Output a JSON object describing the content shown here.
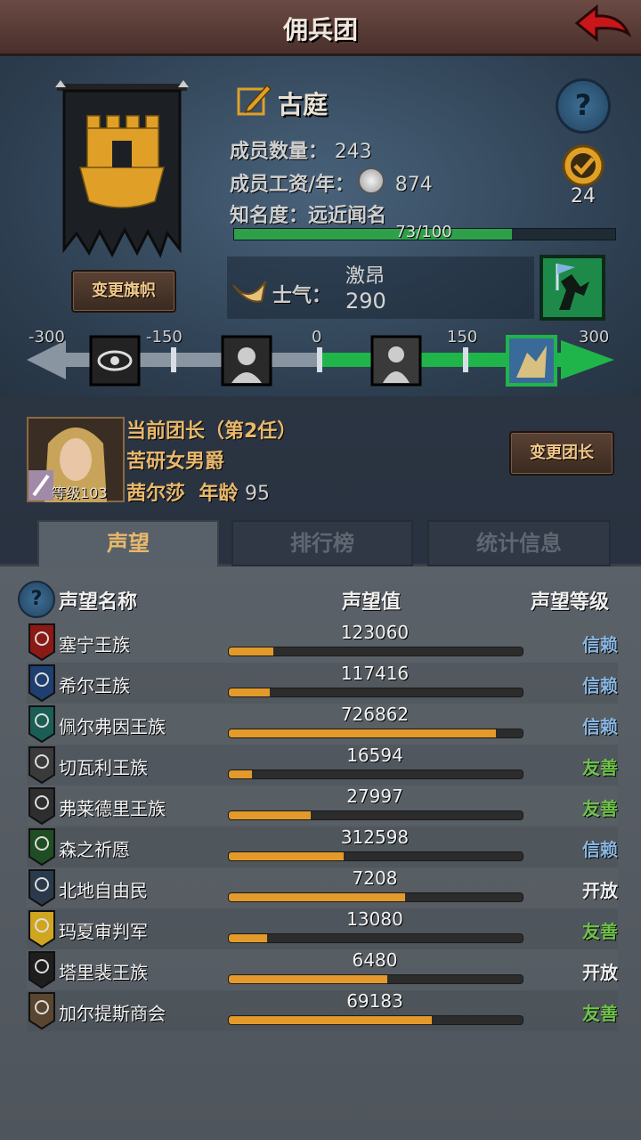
{
  "header": {
    "title": "佣兵团"
  },
  "guild": {
    "name": "古庭",
    "members_label": "成员数量：",
    "members_value": "243",
    "wage_label": "成员工资/年：",
    "wage_value": "874",
    "fame_label": "知名度：",
    "fame_value": "远近闻名",
    "fame_progress_text": "73/100",
    "fame_progress_fraction": 0.73,
    "rank": "24",
    "change_banner_label": "变更旗帜",
    "help_label": "?"
  },
  "morale": {
    "label": "士气：",
    "state": "激昂",
    "value": "290",
    "ticks": [
      "-300",
      "-150",
      "0",
      "150",
      "300"
    ]
  },
  "leader": {
    "title": "当前团长（第2任）",
    "rank_title": "苦研女男爵",
    "level_text": "等级103",
    "name": "茜尔莎",
    "age_label": "年龄",
    "age": "95",
    "change_leader_label": "变更团长"
  },
  "tabs": [
    {
      "label": "声望"
    },
    {
      "label": "排行榜"
    },
    {
      "label": "统计信息"
    }
  ],
  "reputation": {
    "help_label": "?",
    "col_name": "声望名称",
    "col_value": "声望值",
    "col_level": "声望等级",
    "rows": [
      {
        "name": "塞宁王族",
        "value": "123060",
        "level": "信赖",
        "level_color": "#8ab6e0",
        "fill": 0.15,
        "icon_color": "#8b1a16"
      },
      {
        "name": "希尔王族",
        "value": "117416",
        "level": "信赖",
        "level_color": "#8ab6e0",
        "fill": 0.14,
        "icon_color": "#1f3f70"
      },
      {
        "name": "佩尔弗因王族",
        "value": "726862",
        "level": "信赖",
        "level_color": "#8ab6e0",
        "fill": 0.91,
        "icon_color": "#1b5e55"
      },
      {
        "name": "切瓦利王族",
        "value": "16594",
        "level": "友善",
        "level_color": "#6fc24a",
        "fill": 0.08,
        "icon_color": "#3a3a3a"
      },
      {
        "name": "弗莱德里王族",
        "value": "27997",
        "level": "友善",
        "level_color": "#6fc24a",
        "fill": 0.28,
        "icon_color": "#2e2e2e"
      },
      {
        "name": "森之祈愿",
        "value": "312598",
        "level": "信赖",
        "level_color": "#8ab6e0",
        "fill": 0.39,
        "icon_color": "#1f4e24"
      },
      {
        "name": "北地自由民",
        "value": "7208",
        "level": "开放",
        "level_color": "#eeeeee",
        "fill": 0.6,
        "icon_color": "#2a3a4a"
      },
      {
        "name": "玛夏审判军",
        "value": "13080",
        "level": "友善",
        "level_color": "#6fc24a",
        "fill": 0.13,
        "icon_color": "#d0a620"
      },
      {
        "name": "塔里裴王族",
        "value": "6480",
        "level": "开放",
        "level_color": "#eeeeee",
        "fill": 0.54,
        "icon_color": "#1e1e1e"
      },
      {
        "name": "加尔提斯商会",
        "value": "69183",
        "level": "友善",
        "level_color": "#6fc24a",
        "fill": 0.69,
        "icon_color": "#5a4630"
      }
    ]
  }
}
